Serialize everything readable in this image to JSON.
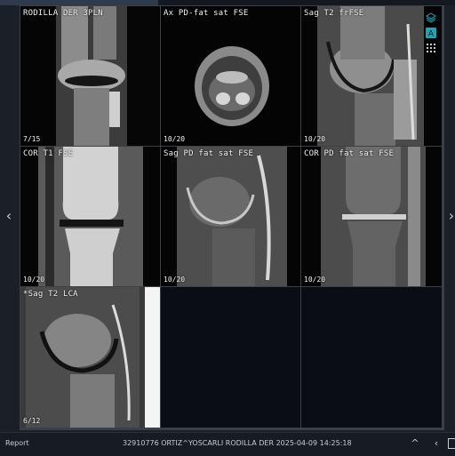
{
  "viewer": {
    "cells": [
      {
        "title": "RODILLA DER 3PLN",
        "frame": "7/15"
      },
      {
        "title": "Ax PD-fat sat FSE",
        "frame": "10/20"
      },
      {
        "title": "Sag T2 frFSE",
        "frame": "10/20"
      },
      {
        "title": "COR T1 FSE",
        "frame": "10/20"
      },
      {
        "title": "Sag PD fat sat FSE",
        "frame": "10/20"
      },
      {
        "title": "COR PD fat sat FSE",
        "frame": "10/20"
      },
      {
        "title": "*Sag T2 LCA",
        "frame": "6/12"
      }
    ]
  },
  "tools": {
    "layers_icon": "layers-icon",
    "annotation_label": "A",
    "grid_icon": "grid-icon",
    "accent_color": "#1aa6b7"
  },
  "navigation": {
    "left_arrow": "‹",
    "right_arrow": "›"
  },
  "bottombar": {
    "report_label": "Report",
    "study_info": "32910776 ORTIZ^YOSCARLI RODILLA DER 2025-04-09 14:25:18",
    "up_label": "^",
    "prev_label": "‹"
  }
}
